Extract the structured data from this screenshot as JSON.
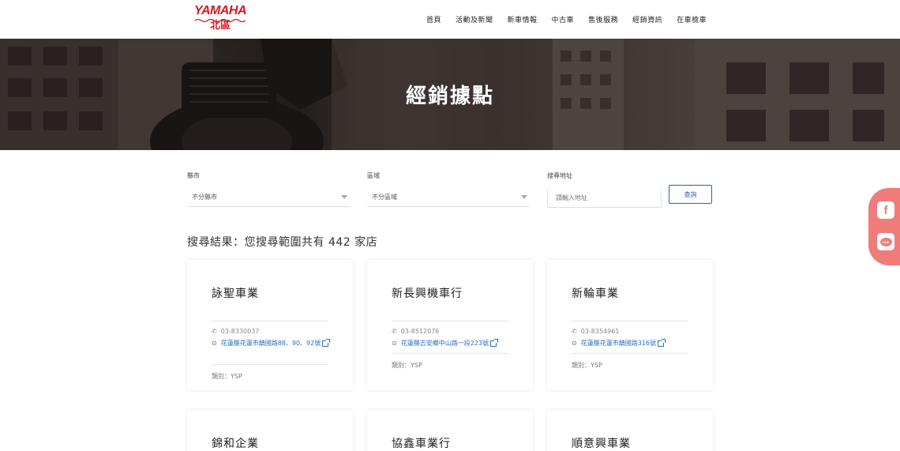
{
  "brand": {
    "logo_top": "YAMAHA",
    "logo_bottom": "北區",
    "color": "#d7191f"
  },
  "nav": {
    "items": [
      "首頁",
      "活動及新聞",
      "新車情報",
      "中古車",
      "售後服務",
      "經銷資訊",
      "在車檢車"
    ]
  },
  "hero": {
    "title": "經銷據點"
  },
  "filters": {
    "county": {
      "label": "縣市",
      "value": "不分縣市"
    },
    "district": {
      "label": "區域",
      "value": "不分區域"
    },
    "keyword": {
      "label": "搜尋地址",
      "placeholder": "請輸入地址"
    },
    "search_button": "查詢"
  },
  "results": {
    "summary": "搜尋結果：您搜尋範圍共有 442 家店"
  },
  "stores": [
    {
      "name": "詠聖車業",
      "phone": "03-8330037",
      "address": "花蓮縣花蓮市鎮國路88、90、92號",
      "type": "類別：YSP"
    },
    {
      "name": "新長興機車行",
      "phone": "03-8512076",
      "address": "花蓮縣吉安鄉中山路一段223號",
      "type": "類別：YSP"
    },
    {
      "name": "新輪車業",
      "phone": "03-8354961",
      "address": "花蓮縣花蓮市鎮國路316號",
      "type": "類別：YSP"
    },
    {
      "name": "錦和企業"
    },
    {
      "name": "協鑫車業行"
    },
    {
      "name": "順意興車業"
    }
  ],
  "accent": "#2a60b0",
  "social_color": "#f07b7b",
  "social": {
    "facebook_icon": "facebook-icon",
    "line_icon": "line-icon",
    "line_text": "LINE"
  }
}
